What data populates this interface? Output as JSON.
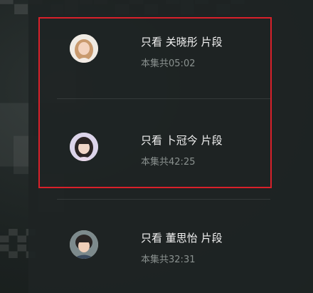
{
  "clip_filter": {
    "items": [
      {
        "prefix": "只看",
        "actor": "关晓彤",
        "suffix": "片段",
        "duration_prefix": "本集共",
        "duration": "05:02"
      },
      {
        "prefix": "只看",
        "actor": "卜冠今",
        "suffix": "片段",
        "duration_prefix": "本集共",
        "duration": "42:25"
      },
      {
        "prefix": "只看",
        "actor": "董思怡",
        "suffix": "片段",
        "duration_prefix": "本集共",
        "duration": "32:31"
      }
    ]
  },
  "annotation": {
    "highlight_color": "#d9202a"
  }
}
